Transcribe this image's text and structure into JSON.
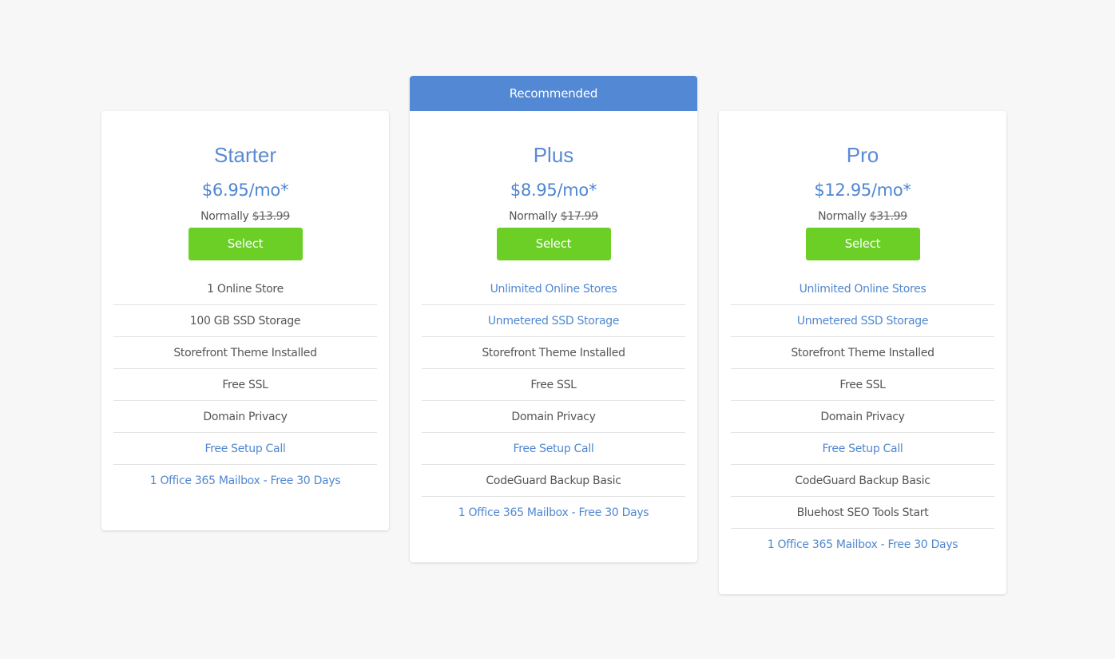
{
  "colors": {
    "accent_blue": "#5388d4",
    "select_green": "#6bcf26",
    "background": "#f7f7f7"
  },
  "plans": [
    {
      "name": "Starter",
      "price": "$6.95/mo*",
      "normally_label": "Normally",
      "normal_price": "$13.99",
      "select_label": "Select",
      "features": [
        {
          "text": "1 Online Store",
          "highlight": false
        },
        {
          "text": "100 GB SSD Storage",
          "highlight": false
        },
        {
          "text": "Storefront Theme Installed",
          "highlight": false
        },
        {
          "text": "Free SSL",
          "highlight": false
        },
        {
          "text": "Domain Privacy",
          "highlight": false
        },
        {
          "text": "Free Setup Call",
          "highlight": true
        },
        {
          "text": "1 Office 365 Mailbox - Free 30 Days",
          "highlight": true
        }
      ]
    },
    {
      "banner": "Recommended",
      "name": "Plus",
      "price": "$8.95/mo*",
      "normally_label": "Normally",
      "normal_price": "$17.99",
      "select_label": "Select",
      "features": [
        {
          "text": "Unlimited Online Stores",
          "highlight": true
        },
        {
          "text": "Unmetered SSD Storage",
          "highlight": true
        },
        {
          "text": "Storefront Theme Installed",
          "highlight": false
        },
        {
          "text": "Free SSL",
          "highlight": false
        },
        {
          "text": "Domain Privacy",
          "highlight": false
        },
        {
          "text": "Free Setup Call",
          "highlight": true
        },
        {
          "text": "CodeGuard Backup Basic",
          "highlight": false
        },
        {
          "text": "1 Office 365 Mailbox - Free 30 Days",
          "highlight": true
        }
      ]
    },
    {
      "name": "Pro",
      "price": "$12.95/mo*",
      "normally_label": "Normally",
      "normal_price": "$31.99",
      "select_label": "Select",
      "features": [
        {
          "text": "Unlimited Online Stores",
          "highlight": true
        },
        {
          "text": "Unmetered SSD Storage",
          "highlight": true
        },
        {
          "text": "Storefront Theme Installed",
          "highlight": false
        },
        {
          "text": "Free SSL",
          "highlight": false
        },
        {
          "text": "Domain Privacy",
          "highlight": false
        },
        {
          "text": "Free Setup Call",
          "highlight": true
        },
        {
          "text": "CodeGuard Backup Basic",
          "highlight": false
        },
        {
          "text": "Bluehost SEO Tools Start",
          "highlight": false
        },
        {
          "text": "1 Office 365 Mailbox - Free 30 Days",
          "highlight": true
        }
      ]
    }
  ]
}
